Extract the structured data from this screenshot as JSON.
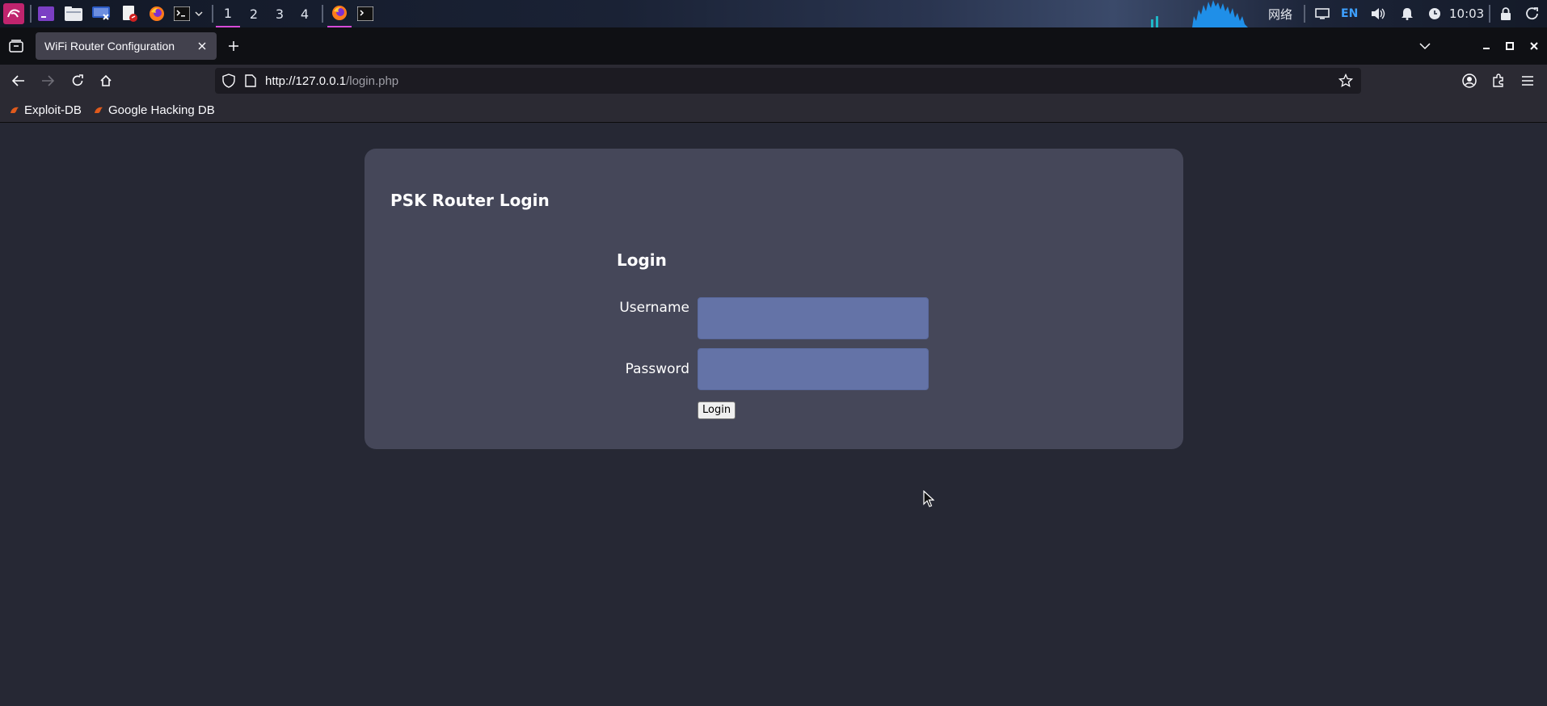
{
  "taskbar": {
    "workspaces": [
      "1",
      "2",
      "3",
      "4"
    ],
    "active_workspace": "1",
    "network_label": "网络",
    "keyboard_layout": "EN",
    "clock": "10:03"
  },
  "browser": {
    "tab_title": "WiFi Router Configuration",
    "url_host": "http://127.0.0.1",
    "url_path": "/login.php",
    "bookmarks": [
      {
        "label": "Exploit-DB"
      },
      {
        "label": "Google Hacking DB"
      }
    ]
  },
  "page": {
    "title": "PSK Router Login",
    "form": {
      "heading": "Login",
      "username_label": "Username",
      "username_value": "",
      "password_label": "Password",
      "password_value": "",
      "submit_label": "Login"
    }
  },
  "colors": {
    "page_bg": "#262834",
    "card_bg": "#454759",
    "input_bg": "#6473a7",
    "accent": "#d64ad8"
  }
}
